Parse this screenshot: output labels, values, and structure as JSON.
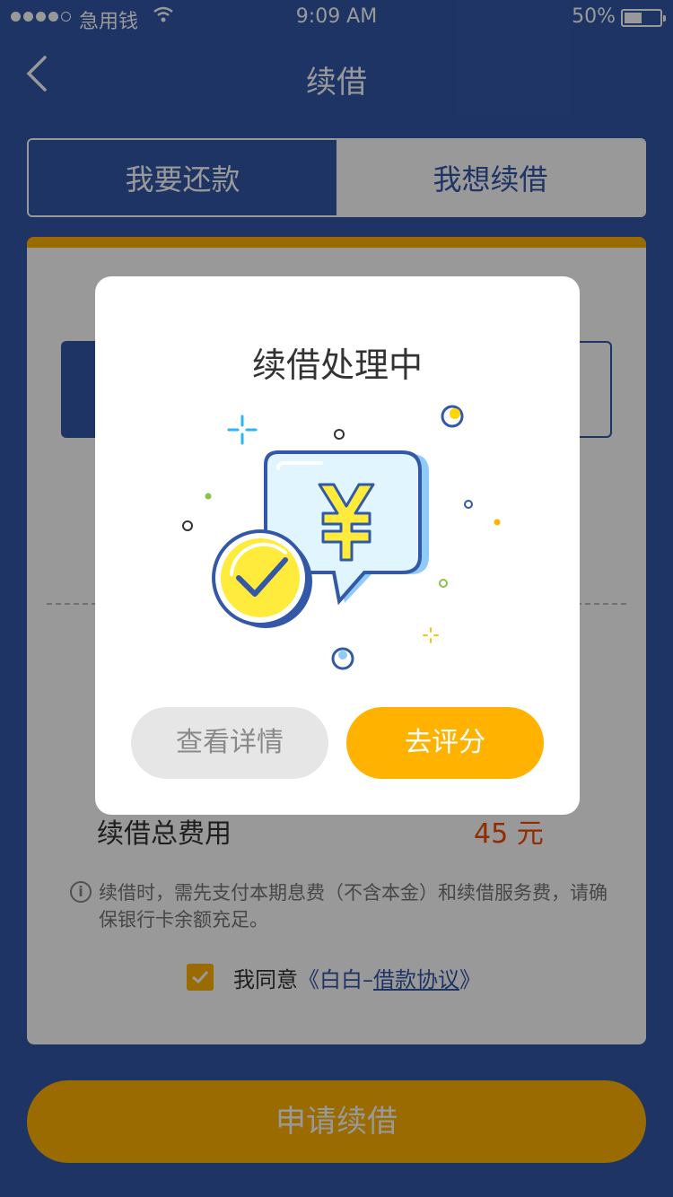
{
  "status_bar": {
    "carrier": "急用钱",
    "time": "9:09 AM",
    "battery_percent": "50%",
    "battery_level": 0.5,
    "signal_bars_filled": 4,
    "signal_bars_total": 5
  },
  "nav": {
    "title": "续借",
    "back_icon": "chevron-left-icon"
  },
  "tabs": [
    {
      "label": "我要还款",
      "selected": false
    },
    {
      "label": "我想续借",
      "selected": true
    }
  ],
  "card": {
    "fee_label": "续借总费用",
    "fee_value": "45 元",
    "note": "续借时，需先支付本期息费（不含本金）和续借服务费，请确保银行卡余额充足。",
    "agree_prefix": "我同意",
    "agree_link_open": "《白白–",
    "agree_link_text": "借款协议",
    "agree_link_close": "》",
    "agree_checked": true
  },
  "apply_button": {
    "label": "申请续借"
  },
  "dialog": {
    "title": "续借处理中",
    "illustration_icon": "yuan-chat-bubble-check-icon",
    "detail_button": "查看详情",
    "rate_button": "去评分"
  },
  "colors": {
    "brand_blue": "#3358a8",
    "accent_orange": "#ffb300",
    "fee_red": "#f04a00",
    "overlay": "rgba(0,0,0,0.4)"
  }
}
